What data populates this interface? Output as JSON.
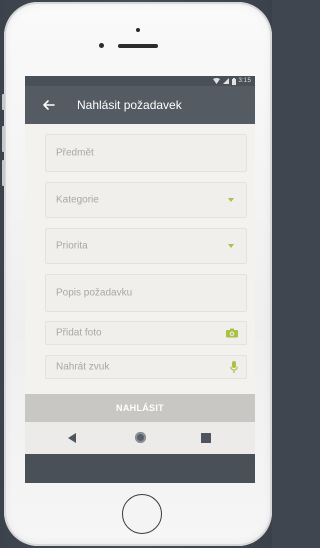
{
  "status_bar": {
    "time": "3:15",
    "icons": [
      "wifi-icon",
      "signal-icon",
      "battery-icon"
    ]
  },
  "app_bar": {
    "title": "Nahlásit požadavek",
    "back_icon": "arrow-left-icon"
  },
  "form": {
    "subject_placeholder": "Předmět",
    "category_placeholder": "Kategorie",
    "priority_placeholder": "Priorita",
    "description_placeholder": "Popis požadavku",
    "add_photo_label": "Přidat foto",
    "add_photo_icon": "camera-icon",
    "record_audio_label": "Nahrát zvuk",
    "record_audio_icon": "microphone-icon",
    "accent_color": "#a8c246"
  },
  "submit": {
    "label": "NAHLÁSIT"
  },
  "nav_bar": {
    "back_icon": "triangle-back-icon",
    "home_icon": "circle-home-icon",
    "recent_icon": "square-recent-icon"
  }
}
